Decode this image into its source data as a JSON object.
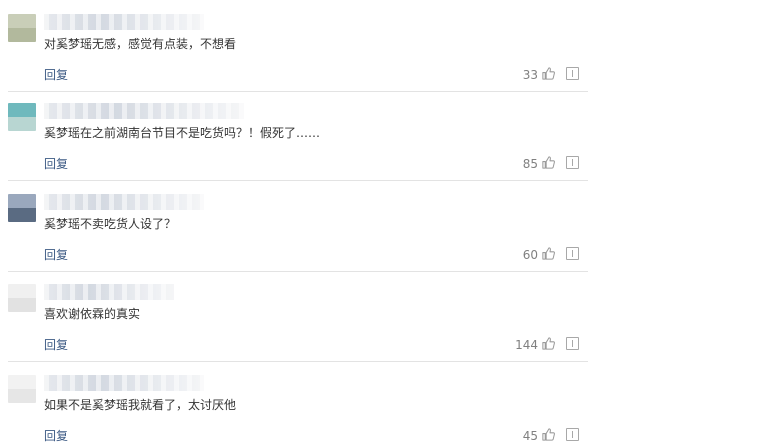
{
  "comments": [
    {
      "text": "对奚梦瑶无感，感觉有点装，不想看",
      "reply_label": "回复",
      "likes": "33",
      "avatar_colors": [
        "#c9ceb8",
        "#b2b99d"
      ]
    },
    {
      "text": "奚梦瑶在之前湖南台节目不是吃货吗？！假死了……",
      "reply_label": "回复",
      "likes": "85",
      "avatar_colors": [
        "#6fb9bd",
        "#b8d6d2"
      ]
    },
    {
      "text": "奚梦瑶不卖吃货人设了？",
      "reply_label": "回复",
      "likes": "60",
      "avatar_colors": [
        "#9aa8bd",
        "#5a6b82"
      ]
    },
    {
      "text": "喜欢谢依霖的真实",
      "reply_label": "回复",
      "likes": "144",
      "avatar_colors": [
        "#f0f0f0",
        "#e2e2e2"
      ]
    },
    {
      "text": "如果不是奚梦瑶我就看了，太讨厌他",
      "reply_label": "回复",
      "likes": "45",
      "avatar_colors": [
        "#f2f2f2",
        "#e6e6e6"
      ]
    }
  ],
  "icons": {
    "like": "thumbs-up-icon",
    "report": "report-icon"
  }
}
